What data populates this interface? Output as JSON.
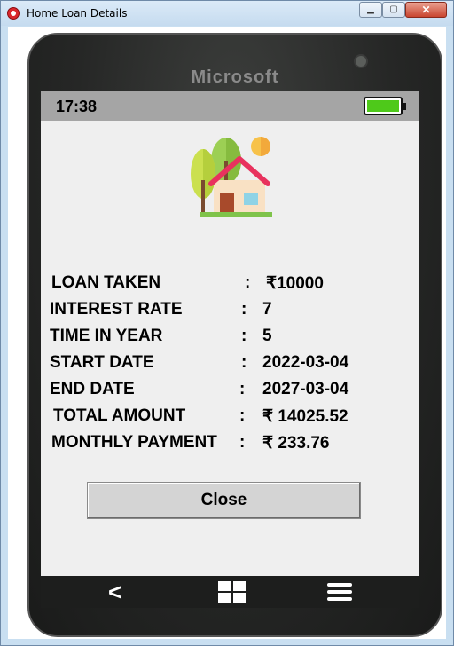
{
  "window": {
    "title": "Home Loan Details",
    "controls": {
      "minimize": "▁",
      "maximize": "▢",
      "close": "✕"
    }
  },
  "phone": {
    "brand": "Microsoft",
    "status": {
      "time": "17:38",
      "battery_level_fraction": 1.0,
      "battery_color": "#4ec91a"
    },
    "illustration": "house-with-trees-icon"
  },
  "details": [
    {
      "label": "LOAN TAKEN",
      "value": "₹10000"
    },
    {
      "label": "INTEREST RATE",
      "value": "7"
    },
    {
      "label": "TIME IN YEAR",
      "value": "5"
    },
    {
      "label": "START DATE",
      "value": "2022-03-04"
    },
    {
      "label": "END DATE",
      "value": "2027-03-04"
    },
    {
      "label": "TOTAL AMOUNT",
      "value": "₹ 14025.52"
    },
    {
      "label": "MONTHLY PAYMENT",
      "value": "₹ 233.76"
    }
  ],
  "colon": ":",
  "actions": {
    "close_label": "Close"
  },
  "navbar": {
    "back_icon": "back-arrow-icon",
    "home_icon": "windows-home-icon",
    "menu_icon": "hamburger-menu-icon"
  }
}
